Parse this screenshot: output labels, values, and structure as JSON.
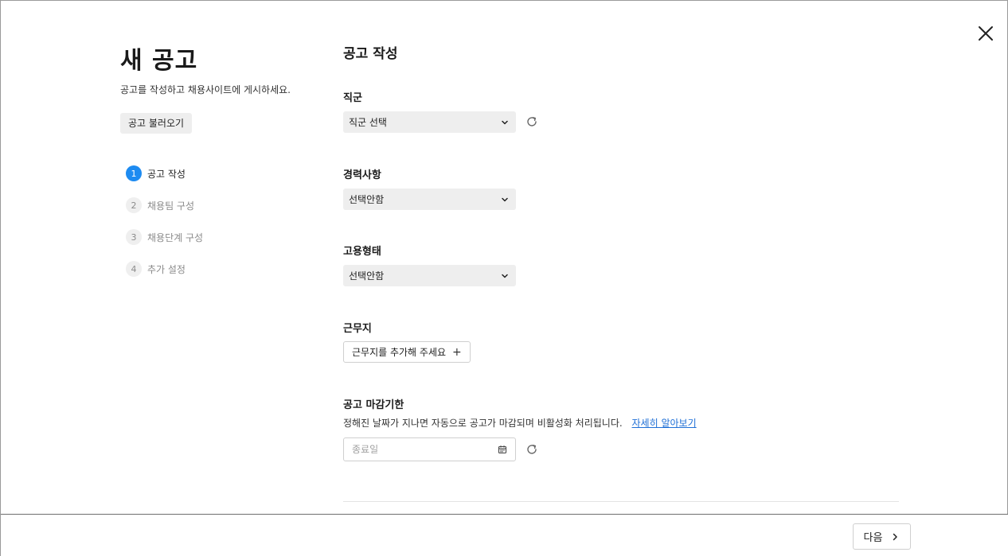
{
  "header": {
    "title": "새 공고",
    "description": "공고를 작성하고 채용사이트에 게시하세요.",
    "load_button": "공고 불러오기"
  },
  "steps": [
    {
      "num": "1",
      "label": "공고 작성",
      "active": true
    },
    {
      "num": "2",
      "label": "채용팀 구성",
      "active": false
    },
    {
      "num": "3",
      "label": "채용단계 구성",
      "active": false
    },
    {
      "num": "4",
      "label": "추가 설정",
      "active": false
    }
  ],
  "form": {
    "title": "공고 작성",
    "job_group": {
      "label": "직군",
      "value": "직군 선택"
    },
    "experience": {
      "label": "경력사항",
      "value": "선택안함"
    },
    "employment": {
      "label": "고용형태",
      "value": "선택안함"
    },
    "location": {
      "label": "근무지",
      "add_button": "근무지를 추가해 주세요",
      "add_icon": "+"
    },
    "deadline": {
      "label": "공고 마감기한",
      "description": "정해진 날짜가 지나면 자동으로 공고가 마감되며 비활성화 처리됩니다.",
      "learn_more": "자세히 알아보기",
      "placeholder": "종료일",
      "value": ""
    }
  },
  "footer": {
    "next_button": "다음"
  },
  "colors": {
    "accent": "#1d8bf1",
    "link": "#1f6fd6",
    "select_bg": "#eeeeee"
  },
  "icons": [
    "close-icon",
    "chevron-down-icon",
    "refresh-icon",
    "calendar-icon",
    "plus-icon",
    "chevron-right-icon"
  ]
}
